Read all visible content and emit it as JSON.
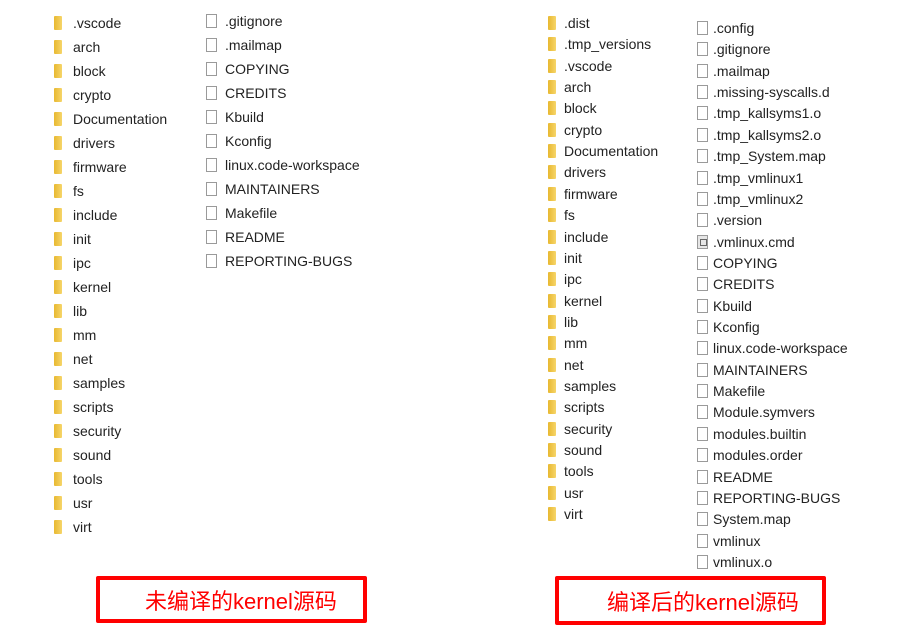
{
  "left": {
    "folders": [
      ".vscode",
      "arch",
      "block",
      "crypto",
      "Documentation",
      "drivers",
      "firmware",
      "fs",
      "include",
      "init",
      "ipc",
      "kernel",
      "lib",
      "mm",
      "net",
      "samples",
      "scripts",
      "security",
      "sound",
      "tools",
      "usr",
      "virt"
    ],
    "files": [
      ".gitignore",
      ".mailmap",
      "COPYING",
      "CREDITS",
      "Kbuild",
      "Kconfig",
      "linux.code-workspace",
      "MAINTAINERS",
      "Makefile",
      "README",
      "REPORTING-BUGS"
    ],
    "caption": "未编译的kernel源码"
  },
  "right": {
    "folders": [
      ".dist",
      ".tmp_versions",
      ".vscode",
      "arch",
      "block",
      "crypto",
      "Documentation",
      "drivers",
      "firmware",
      "fs",
      "include",
      "init",
      "ipc",
      "kernel",
      "lib",
      "mm",
      "net",
      "samples",
      "scripts",
      "security",
      "sound",
      "tools",
      "usr",
      "virt"
    ],
    "files": [
      ".config",
      ".gitignore",
      ".mailmap",
      ".missing-syscalls.d",
      ".tmp_kallsyms1.o",
      ".tmp_kallsyms2.o",
      ".tmp_System.map",
      ".tmp_vmlinux1",
      ".tmp_vmlinux2",
      ".version",
      ".vmlinux.cmd",
      "COPYING",
      "CREDITS",
      "Kbuild",
      "Kconfig",
      "linux.code-workspace",
      "MAINTAINERS",
      "Makefile",
      "Module.symvers",
      "modules.builtin",
      "modules.order",
      "README",
      "REPORTING-BUGS",
      "System.map",
      "vmlinux",
      "vmlinux.o"
    ],
    "caption": "编译后的kernel源码"
  },
  "colors": {
    "folder": "#f0c64a",
    "caption": "#ff0000"
  }
}
